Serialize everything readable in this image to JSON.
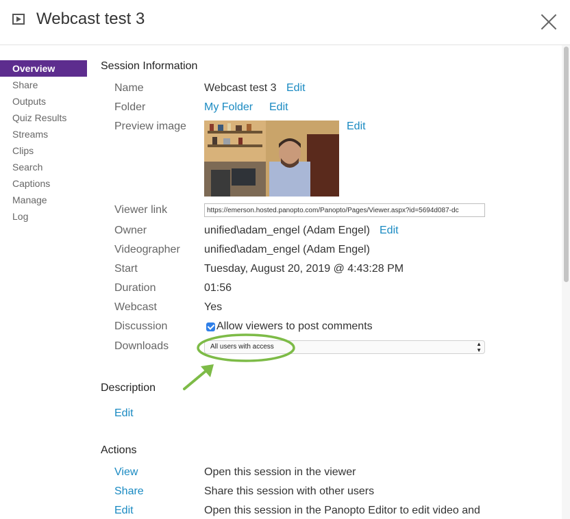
{
  "header": {
    "title": "Webcast test 3"
  },
  "sidebar": {
    "items": [
      "Overview",
      "Share",
      "Outputs",
      "Quiz Results",
      "Streams",
      "Clips",
      "Search",
      "Captions",
      "Manage",
      "Log"
    ]
  },
  "session": {
    "heading": "Session Information",
    "name_label": "Name",
    "name_value": "Webcast test 3",
    "name_edit": "Edit",
    "folder_label": "Folder",
    "folder_value": "My Folder",
    "folder_edit": "Edit",
    "preview_label": "Preview image",
    "preview_edit": "Edit",
    "viewer_label": "Viewer link",
    "viewer_value": "https://emerson.hosted.panopto.com/Panopto/Pages/Viewer.aspx?id=5694d087-dc",
    "owner_label": "Owner",
    "owner_value": "unified\\adam_engel (Adam Engel)",
    "owner_edit": "Edit",
    "videographer_label": "Videographer",
    "videographer_value": "unified\\adam_engel (Adam Engel)",
    "start_label": "Start",
    "start_value": "Tuesday, August 20, 2019 @ 4:43:28 PM",
    "duration_label": "Duration",
    "duration_value": "01:56",
    "webcast_label": "Webcast",
    "webcast_value": "Yes",
    "discussion_label": "Discussion",
    "discussion_value": "Allow viewers to post comments",
    "downloads_label": "Downloads",
    "downloads_value": "All users with access"
  },
  "description": {
    "heading": "Description",
    "edit": "Edit"
  },
  "actions": {
    "heading": "Actions",
    "items": [
      {
        "label": "View",
        "desc": "Open this session in the viewer"
      },
      {
        "label": "Share",
        "desc": "Share this session with other users"
      },
      {
        "label": "Edit",
        "desc": "Open this session in the Panopto Editor to edit video and"
      }
    ]
  },
  "colors": {
    "accent": "#5d2d8e",
    "link": "#1a8ac2",
    "annotation": "#7dbb47"
  }
}
